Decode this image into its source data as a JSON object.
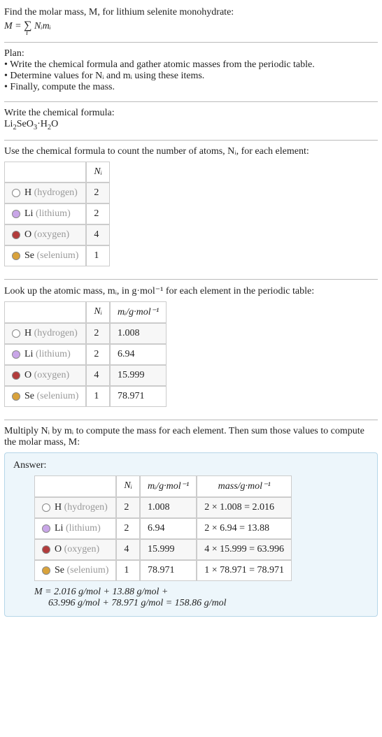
{
  "chart_data": {
    "type": "table",
    "title": "Molar mass calculation for lithium selenite monohydrate (Li2SeO3·H2O)",
    "columns": [
      "element",
      "N_i",
      "m_i (g·mol⁻¹)",
      "mass (g·mol⁻¹)"
    ],
    "rows": [
      {
        "element": "H (hydrogen)",
        "N_i": 2,
        "m_i": 1.008,
        "mass_expr": "2 × 1.008 = 2.016",
        "mass": 2.016
      },
      {
        "element": "Li (lithium)",
        "N_i": 2,
        "m_i": 6.94,
        "mass_expr": "2 × 6.94 = 13.88",
        "mass": 13.88
      },
      {
        "element": "O (oxygen)",
        "N_i": 4,
        "m_i": 15.999,
        "mass_expr": "4 × 15.999 = 63.996",
        "mass": 63.996
      },
      {
        "element": "Se (selenium)",
        "N_i": 1,
        "m_i": 78.971,
        "mass_expr": "1 × 78.971 = 78.971",
        "mass": 78.971
      }
    ],
    "molar_mass": 158.86,
    "molar_mass_expr": "M = 2.016 g/mol + 13.88 g/mol + 63.996 g/mol + 78.971 g/mol = 158.86 g/mol"
  },
  "intro": {
    "line1": "Find the molar mass, M, for lithium selenite monohydrate:",
    "eq_left": "M = ",
    "eq_sum_sym": "∑",
    "eq_sub": "i",
    "eq_rest": " Nᵢmᵢ"
  },
  "plan": {
    "title": "Plan:",
    "b1": "• Write the chemical formula and gather atomic masses from the periodic table.",
    "b2": "• Determine values for Nᵢ and mᵢ using these items.",
    "b3": "• Finally, compute the mass."
  },
  "chem": {
    "title": "Write the chemical formula:",
    "formula_parts": {
      "p1": "Li",
      "s1": "2",
      "p2": "SeO",
      "s2": "3",
      "p3": "·H",
      "s3": "2",
      "p4": "O"
    }
  },
  "count": {
    "title": "Use the chemical formula to count the number of atoms, Nᵢ, for each element:",
    "head_ni": "Nᵢ",
    "rows": [
      {
        "sym": "H",
        "name": "(hydrogen)",
        "color": "#ffffff",
        "ni": "2"
      },
      {
        "sym": "Li",
        "name": "(lithium)",
        "color": "#c9a6e8",
        "ni": "2"
      },
      {
        "sym": "O",
        "name": "(oxygen)",
        "color": "#b23b3b",
        "ni": "4"
      },
      {
        "sym": "Se",
        "name": "(selenium)",
        "color": "#d9a23b",
        "ni": "1"
      }
    ]
  },
  "masses": {
    "title": "Look up the atomic mass, mᵢ, in g·mol⁻¹ for each element in the periodic table:",
    "head_ni": "Nᵢ",
    "head_mi": "mᵢ/g·mol⁻¹",
    "rows": [
      {
        "sym": "H",
        "name": "(hydrogen)",
        "color": "#ffffff",
        "ni": "2",
        "mi": "1.008"
      },
      {
        "sym": "Li",
        "name": "(lithium)",
        "color": "#c9a6e8",
        "ni": "2",
        "mi": "6.94"
      },
      {
        "sym": "O",
        "name": "(oxygen)",
        "color": "#b23b3b",
        "ni": "4",
        "mi": "15.999"
      },
      {
        "sym": "Se",
        "name": "(selenium)",
        "color": "#d9a23b",
        "ni": "1",
        "mi": "78.971"
      }
    ]
  },
  "mult": {
    "title": "Multiply Nᵢ by mᵢ to compute the mass for each element. Then sum those values to compute the molar mass, M:"
  },
  "answer": {
    "label": "Answer:",
    "head_ni": "Nᵢ",
    "head_mi": "mᵢ/g·mol⁻¹",
    "head_mass": "mass/g·mol⁻¹",
    "rows": [
      {
        "sym": "H",
        "name": "(hydrogen)",
        "color": "#ffffff",
        "ni": "2",
        "mi": "1.008",
        "mass": "2 × 1.008 = 2.016"
      },
      {
        "sym": "Li",
        "name": "(lithium)",
        "color": "#c9a6e8",
        "ni": "2",
        "mi": "6.94",
        "mass": "2 × 6.94 = 13.88"
      },
      {
        "sym": "O",
        "name": "(oxygen)",
        "color": "#b23b3b",
        "ni": "4",
        "mi": "15.999",
        "mass": "4 × 15.999 = 63.996"
      },
      {
        "sym": "Se",
        "name": "(selenium)",
        "color": "#d9a23b",
        "ni": "1",
        "mi": "78.971",
        "mass": "1 × 78.971 = 78.971"
      }
    ],
    "sum_line1": "M = 2.016 g/mol + 13.88 g/mol +",
    "sum_line2": "63.996 g/mol + 78.971 g/mol = 158.86 g/mol"
  }
}
